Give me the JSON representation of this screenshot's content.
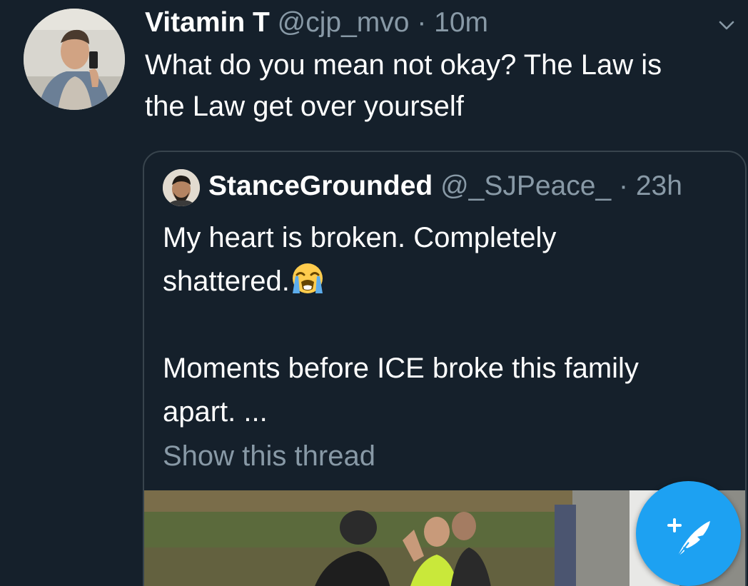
{
  "tweet": {
    "display_name": "Vitamin T",
    "handle": "@cjp_mvo",
    "separator": "·",
    "time": "10m",
    "text_line1": "What do you mean not okay? The Law is",
    "text_line2": "the Law get over yourself"
  },
  "quoted_tweet": {
    "display_name": "StanceGrounded",
    "handle": "@_SJPeace_",
    "separator": "·",
    "time": "23h",
    "line1": "My heart is broken. Completely",
    "line2": "shattered.",
    "line3": "",
    "line4": "Moments before ICE broke this family",
    "line5": "apart. ...",
    "show_thread": "Show this thread"
  },
  "icons": {
    "caret": "chevron-down-icon",
    "emoji": "loudly-crying-face-emoji",
    "compose": "compose-tweet-icon"
  },
  "colors": {
    "background": "#15202b",
    "secondary_text": "#8899a6",
    "border": "#38444d",
    "accent": "#1da1f2"
  }
}
